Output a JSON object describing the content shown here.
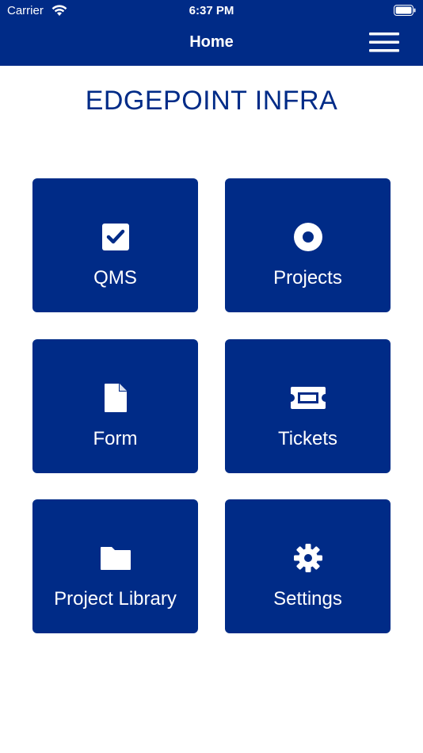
{
  "status_bar": {
    "carrier": "Carrier",
    "time": "6:37 PM"
  },
  "header": {
    "title": "Home",
    "menu_icon": "hamburger-menu-icon"
  },
  "brand": {
    "title": "EDGEPOINT INFRA"
  },
  "tiles": [
    {
      "label": "QMS",
      "icon": "checkbox-icon"
    },
    {
      "label": "Projects",
      "icon": "target-icon"
    },
    {
      "label": "Form",
      "icon": "document-icon"
    },
    {
      "label": "Tickets",
      "icon": "ticket-icon"
    },
    {
      "label": "Project Library",
      "icon": "folder-icon"
    },
    {
      "label": "Settings",
      "icon": "gear-icon"
    }
  ],
  "colors": {
    "primary": "#002b87",
    "background": "#ffffff",
    "text_on_primary": "#ffffff"
  }
}
